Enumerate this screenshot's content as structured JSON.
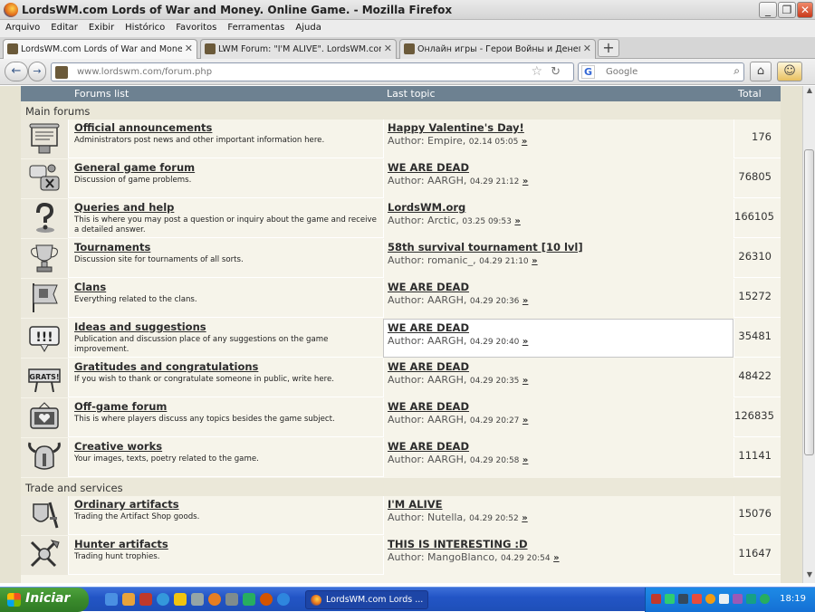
{
  "window": {
    "title": "LordsWM.com Lords of War and Money. Online Game. - Mozilla Firefox"
  },
  "menu": [
    "Arquivo",
    "Editar",
    "Exibir",
    "Histórico",
    "Favoritos",
    "Ferramentas",
    "Ajuda"
  ],
  "tabs": [
    {
      "label": "LordsWM.com Lords of War and Money. ..."
    },
    {
      "label": "LWM Forum: \"I'M ALIVE\". LordsWM.com L..."
    },
    {
      "label": "Онлайн игры - Герои Войны и Денег, ..."
    }
  ],
  "address": {
    "url": "www.lordswm.com/forum.php"
  },
  "search": {
    "placeholder": "Google",
    "engine_icon": "G"
  },
  "header": {
    "forums": "Forums list",
    "last": "Last topic",
    "total": "Total"
  },
  "sections": [
    {
      "title": "Main forums",
      "forums": [
        {
          "icon": "scroll-announcement-icon",
          "title": "Official announcements",
          "desc": "Administrators post news and other important information here.",
          "last_topic": "Happy Valentine's Day!",
          "author": "Author: Empire, ",
          "date": "02.14 05:05",
          "go": "»",
          "total": "176"
        },
        {
          "icon": "chat-bubbles-icon",
          "title": "General game forum",
          "desc": "Discussion of game problems.",
          "last_topic": "WE ARE DEAD",
          "author": "Author: AARGH, ",
          "date": "04.29 21:12",
          "go": "»",
          "total": "76805"
        },
        {
          "icon": "question-mark-icon",
          "title": "Queries and help",
          "desc": "This is where you may post a question or inquiry about the game and receive a detailed answer.",
          "last_topic": "LordsWM.org",
          "author": "Author: Arctic, ",
          "date": "03.25 09:53",
          "go": "»",
          "total": "166105"
        },
        {
          "icon": "trophy-icon",
          "title": "Tournaments",
          "desc": "Discussion site for tournaments of all sorts.",
          "last_topic": "58th survival tournament [10 lvl]",
          "author": "Author: romanic_, ",
          "date": "04.29 21:10",
          "go": "»",
          "total": "26310"
        },
        {
          "icon": "clan-banner-icon",
          "title": "Clans",
          "desc": "Everything related to the clans.",
          "last_topic": "WE ARE DEAD",
          "author": "Author: AARGH, ",
          "date": "04.29 20:36",
          "go": "»",
          "total": "15272"
        },
        {
          "icon": "exclamation-sign-icon",
          "title": "Ideas and suggestions",
          "desc": "Publication and discussion place of any suggestions on the game improvement.",
          "last_topic": "WE ARE DEAD",
          "author": "Author: AARGH, ",
          "date": "04.29 20:40",
          "go": "»",
          "total": "35481"
        },
        {
          "icon": "grats-sign-icon",
          "title": "Gratitudes and congratulations",
          "desc": "If you wish to thank or congratulate someone in public, write here.",
          "last_topic": "WE ARE DEAD",
          "author": "Author: AARGH, ",
          "date": "04.29 20:35",
          "go": "»",
          "total": "48422"
        },
        {
          "icon": "tv-heart-icon",
          "title": "Off-game forum",
          "desc": "This is where players discuss any topics besides the game subject.",
          "last_topic": "WE ARE DEAD",
          "author": "Author: AARGH, ",
          "date": "04.29 20:27",
          "go": "»",
          "total": "126835"
        },
        {
          "icon": "viking-helmet-icon",
          "title": "Creative works",
          "desc": "Your images, texts, poetry related to the game.",
          "last_topic": "WE ARE DEAD",
          "author": "Author: AARGH, ",
          "date": "04.29 20:58",
          "go": "»",
          "total": "11141"
        }
      ]
    },
    {
      "title": "Trade and services",
      "forums": [
        {
          "icon": "artifact-shield-icon",
          "title": "Ordinary artifacts",
          "desc": "Trading the Artifact Shop goods.",
          "last_topic": "I'M ALIVE",
          "author": "Author: Nutella, ",
          "date": "04.29 20:52",
          "go": "»",
          "total": "15076"
        },
        {
          "icon": "hunter-weapons-icon",
          "title": "Hunter artifacts",
          "desc": "Trading hunt trophies.",
          "last_topic": "THIS IS INTERESTING :D",
          "author": "Author: MangoBlanco, ",
          "date": "04.29 20:54",
          "go": "»",
          "total": "11647"
        }
      ]
    }
  ],
  "taskbar": {
    "start": "Iniciar",
    "window_button": "LordsWM.com Lords ...",
    "clock": "18:19"
  },
  "colors": {
    "header": "#6d8191",
    "row_bg": "#f6f4ea",
    "section_bg": "#ebe8d9",
    "taskbar": "#2355c6",
    "start": "#3a8a2c"
  }
}
